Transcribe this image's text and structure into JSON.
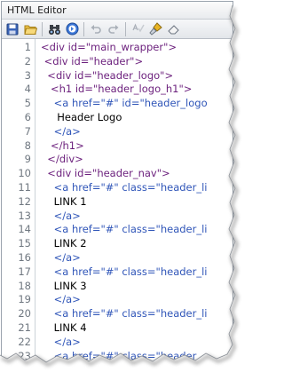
{
  "window": {
    "title": "HTML Editor"
  },
  "toolbar": {
    "buttons": [
      {
        "icon": "save-icon"
      },
      {
        "icon": "open-folder-icon"
      },
      {
        "icon": "find-binoculars-icon"
      },
      {
        "icon": "navigate-circle-icon"
      },
      {
        "icon": "undo-icon"
      },
      {
        "icon": "redo-icon"
      },
      {
        "icon": "spellcheck-icon"
      },
      {
        "icon": "brush-icon"
      },
      {
        "icon": "eraser-icon"
      }
    ]
  },
  "editor": {
    "line_numbers": [
      "1",
      "2",
      "3",
      "4",
      "5",
      "6",
      "7",
      "8",
      "9",
      "10",
      "11",
      "12",
      "13",
      "14",
      "15",
      "16",
      "17",
      "18",
      "19",
      "20",
      "21",
      "22",
      "23"
    ],
    "lines": [
      [
        {
          "t": "<div id=\"main_wrapper\">",
          "c": "tag"
        }
      ],
      [
        {
          "t": " <div id=\"header\">",
          "c": "tag"
        }
      ],
      [
        {
          "t": "  <div id=\"header_logo\">",
          "c": "tag"
        }
      ],
      [
        {
          "t": "   <h1 id=\"header_logo_h1\">",
          "c": "tag"
        }
      ],
      [
        {
          "t": "    <a href=\"#\" id=\"header_logo",
          "c": "attr"
        }
      ],
      [
        {
          "t": "     Header Logo",
          "c": "txt"
        }
      ],
      [
        {
          "t": "    </a>",
          "c": "attr"
        }
      ],
      [
        {
          "t": "   </h1>",
          "c": "tag"
        }
      ],
      [
        {
          "t": "  </div>",
          "c": "tag"
        }
      ],
      [
        {
          "t": "  <div id=\"header_nav\">",
          "c": "tag"
        }
      ],
      [
        {
          "t": "    <a href=\"#\" class=\"header_li",
          "c": "attr"
        }
      ],
      [
        {
          "t": "    LINK 1",
          "c": "txt"
        }
      ],
      [
        {
          "t": "    </a>",
          "c": "attr"
        }
      ],
      [
        {
          "t": "    <a href=\"#\" class=\"header_li",
          "c": "attr"
        }
      ],
      [
        {
          "t": "    LINK 2",
          "c": "txt"
        }
      ],
      [
        {
          "t": "    </a>",
          "c": "attr"
        }
      ],
      [
        {
          "t": "    <a href=\"#\" class=\"header_li",
          "c": "attr"
        }
      ],
      [
        {
          "t": "    LINK 3",
          "c": "txt"
        }
      ],
      [
        {
          "t": "    </a>",
          "c": "attr"
        }
      ],
      [
        {
          "t": "    <a href=\"#\" class=\"header_li",
          "c": "attr"
        }
      ],
      [
        {
          "t": "    LINK 4",
          "c": "txt"
        }
      ],
      [
        {
          "t": "    </a>",
          "c": "attr"
        }
      ],
      [
        {
          "t": "    <a href=\"#\" class=\"header",
          "c": "attr"
        }
      ]
    ]
  },
  "colors": {
    "tag": "#6b1f7c",
    "attribute": "#2f55b8",
    "text": "#000000",
    "line_number": "#6f7780"
  }
}
